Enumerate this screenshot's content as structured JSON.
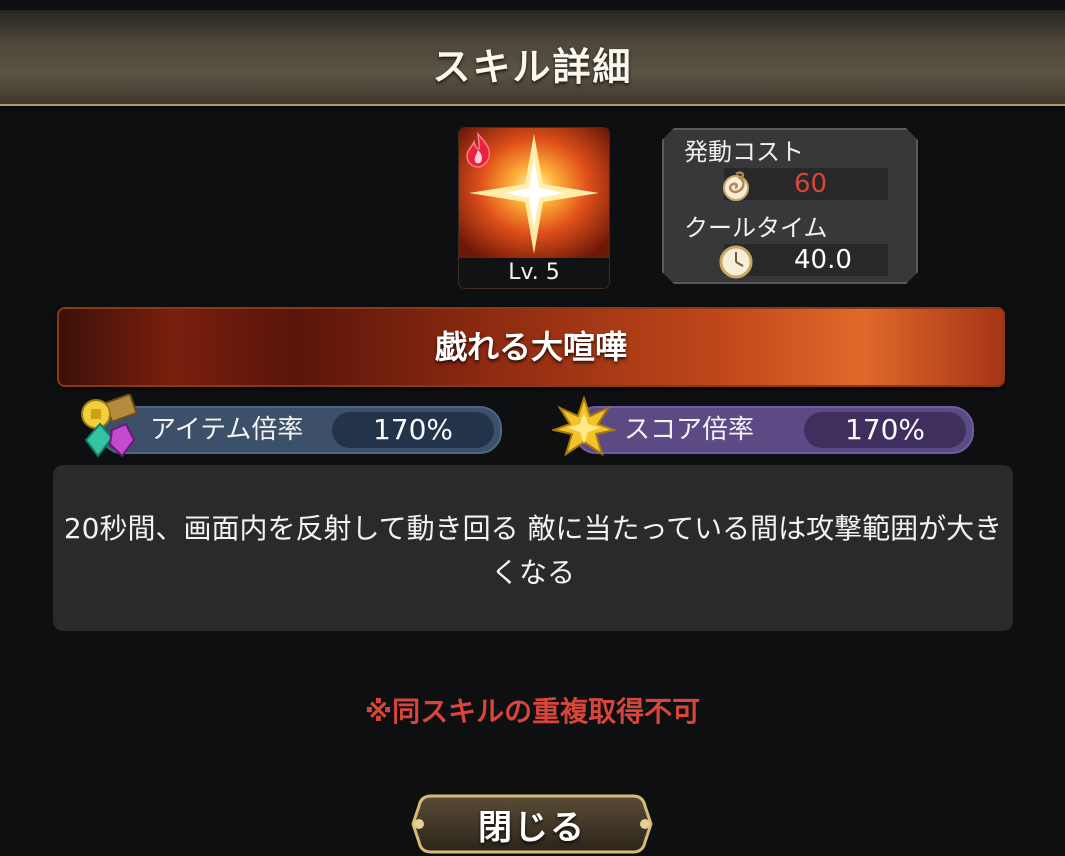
{
  "header": {
    "title": "スキル詳細"
  },
  "skill": {
    "level_label": "Lv. 5",
    "element_icon": "fire-icon",
    "name": "戯れる大喧嘩",
    "description": "20秒間、画面内を反射して動き回る 敵に当たっている間は攻撃範囲が大きくなる"
  },
  "cost_panel": {
    "cost_label": "発動コスト",
    "cost_icon": "swirl-icon",
    "cost_value": "60",
    "cooltime_label": "クールタイム",
    "cooltime_icon": "clock-icon",
    "cooltime_value": "40.0"
  },
  "multipliers": {
    "item": {
      "label": "アイテム倍率",
      "value": "170%",
      "icon": "gems-icon"
    },
    "score": {
      "label": "スコア倍率",
      "value": "170%",
      "icon": "star-icon"
    }
  },
  "warning": "※同スキルの重複取得不可",
  "close_button": {
    "label": "閉じる"
  },
  "colors": {
    "cost_value": "#d8453c",
    "warning": "#d8453c",
    "item_pill": "#3c5069",
    "score_pill": "#5c4a84",
    "gold_frame": "#c9a863"
  }
}
